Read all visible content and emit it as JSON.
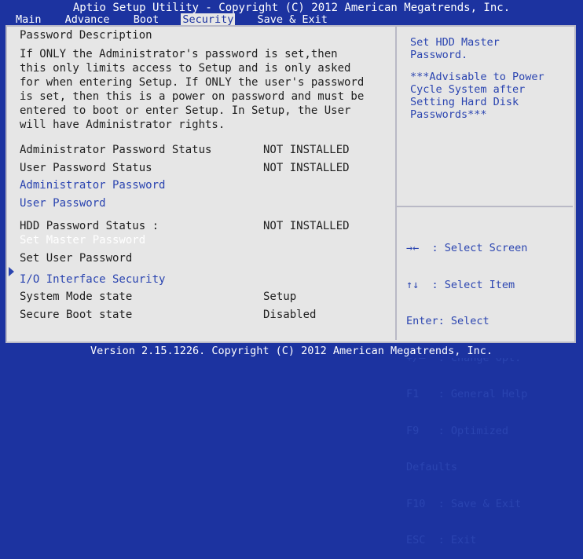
{
  "title": "Aptio Setup Utility - Copyright (C) 2012 American Megatrends, Inc.",
  "tabs": [
    {
      "label": "Main"
    },
    {
      "label": "Advance"
    },
    {
      "label": "Boot"
    },
    {
      "label": "Security"
    },
    {
      "label": "Save & Exit"
    }
  ],
  "active_tab": "Security",
  "left": {
    "password_heading": "Password Description",
    "password_description": "If ONLY the Administrator's password is set,then\nthis only limits access to Setup and is only asked\nfor when entering Setup. If ONLY the user's password\nis set, then this is a power on password and must be\nentered to boot or enter Setup. In Setup, the User\nwill have Administrator rights.",
    "admin_status_label": "Administrator Password Status",
    "admin_status_value": "NOT INSTALLED",
    "user_status_label": "User Password Status",
    "user_status_value": "NOT INSTALLED",
    "admin_password": "Administrator Password",
    "user_password": "User Password",
    "hdd_status_label": "HDD Password Status :",
    "hdd_status_value": "NOT INSTALLED",
    "set_master_password": "Set Master Password",
    "set_user_password": "Set User Password",
    "io_interface_security": "I/O Interface Security",
    "system_mode_label": "System Mode state",
    "system_mode_value": "Setup",
    "secure_boot_label": "Secure Boot state",
    "secure_boot_value": "Disabled"
  },
  "help": {
    "line1": "Set HDD Master\nPassword.",
    "line2": "***Advisable to Power\nCycle System after\nSetting Hard Disk\nPasswords***"
  },
  "keys": {
    "select_screen": "→←  : Select Screen",
    "select_item": "↑↓  : Select Item",
    "enter": "Enter: Select",
    "change": "+/—  : Change Opt.",
    "f1": "F1   : General Help",
    "f9": "F9   : Optimized",
    "f9b": "Defaults",
    "f10": "F10  : Save & Exit",
    "esc": "ESC  : Exit"
  },
  "footer": "Version 2.15.1226. Copyright (C) 2012 American Megatrends, Inc.",
  "colors": {
    "background": "#1c33a0",
    "panel": "#e6e6e6",
    "text": "#202020",
    "link": "#2a44b0",
    "selected": "#ffffff"
  }
}
